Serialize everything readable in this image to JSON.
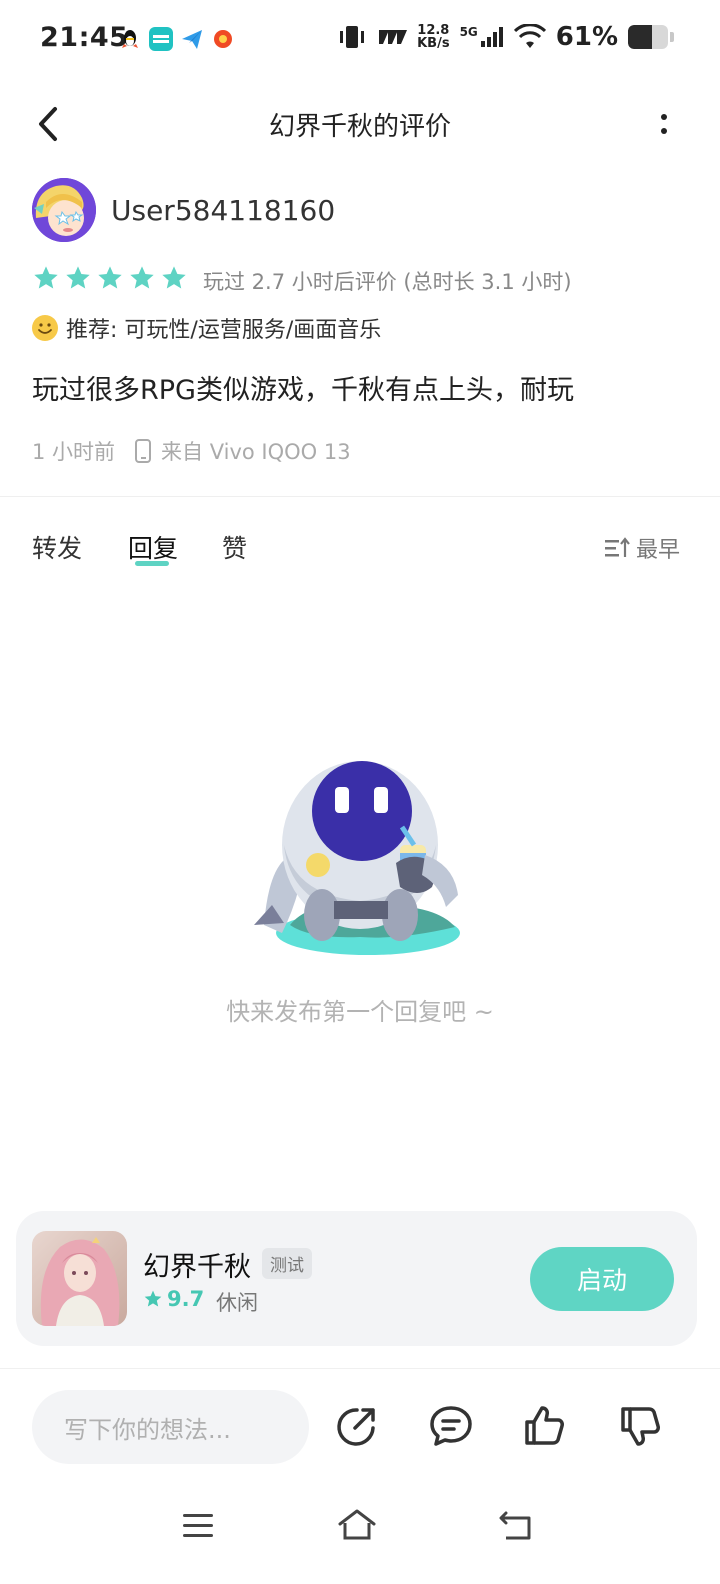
{
  "status_bar": {
    "time": "21:45",
    "net_speed_top": "12.8",
    "net_speed_bottom": "KB/s",
    "network": "5G",
    "battery": "61%",
    "battery_level": 0.61
  },
  "header": {
    "title": "幻界千秋的评价"
  },
  "review": {
    "username": "User584118160",
    "star_count": 5,
    "play_info": "玩过 2.7 小时后评价 (总时长 3.1 小时)",
    "recommend": "推荐: 可玩性/运营服务/画面音乐",
    "text": "玩过很多RPG类似游戏，千秋有点上头，耐玩",
    "time_ago": "1 小时前",
    "device": "来自 Vivo IQOO 13"
  },
  "tabs": {
    "items": [
      "转发",
      "回复",
      "赞"
    ],
    "active": "回复",
    "sort_label": "最早"
  },
  "empty_state": {
    "message": "快来发布第一个回复吧 ~"
  },
  "game": {
    "name": "幻界千秋",
    "badge": "测试",
    "rating": "9.7",
    "genre": "休闲",
    "launch_label": "启动"
  },
  "bottom_bar": {
    "input_placeholder": "写下你的想法..."
  },
  "colors": {
    "accent": "#5ed3c3",
    "star": "#5ed3c3"
  }
}
